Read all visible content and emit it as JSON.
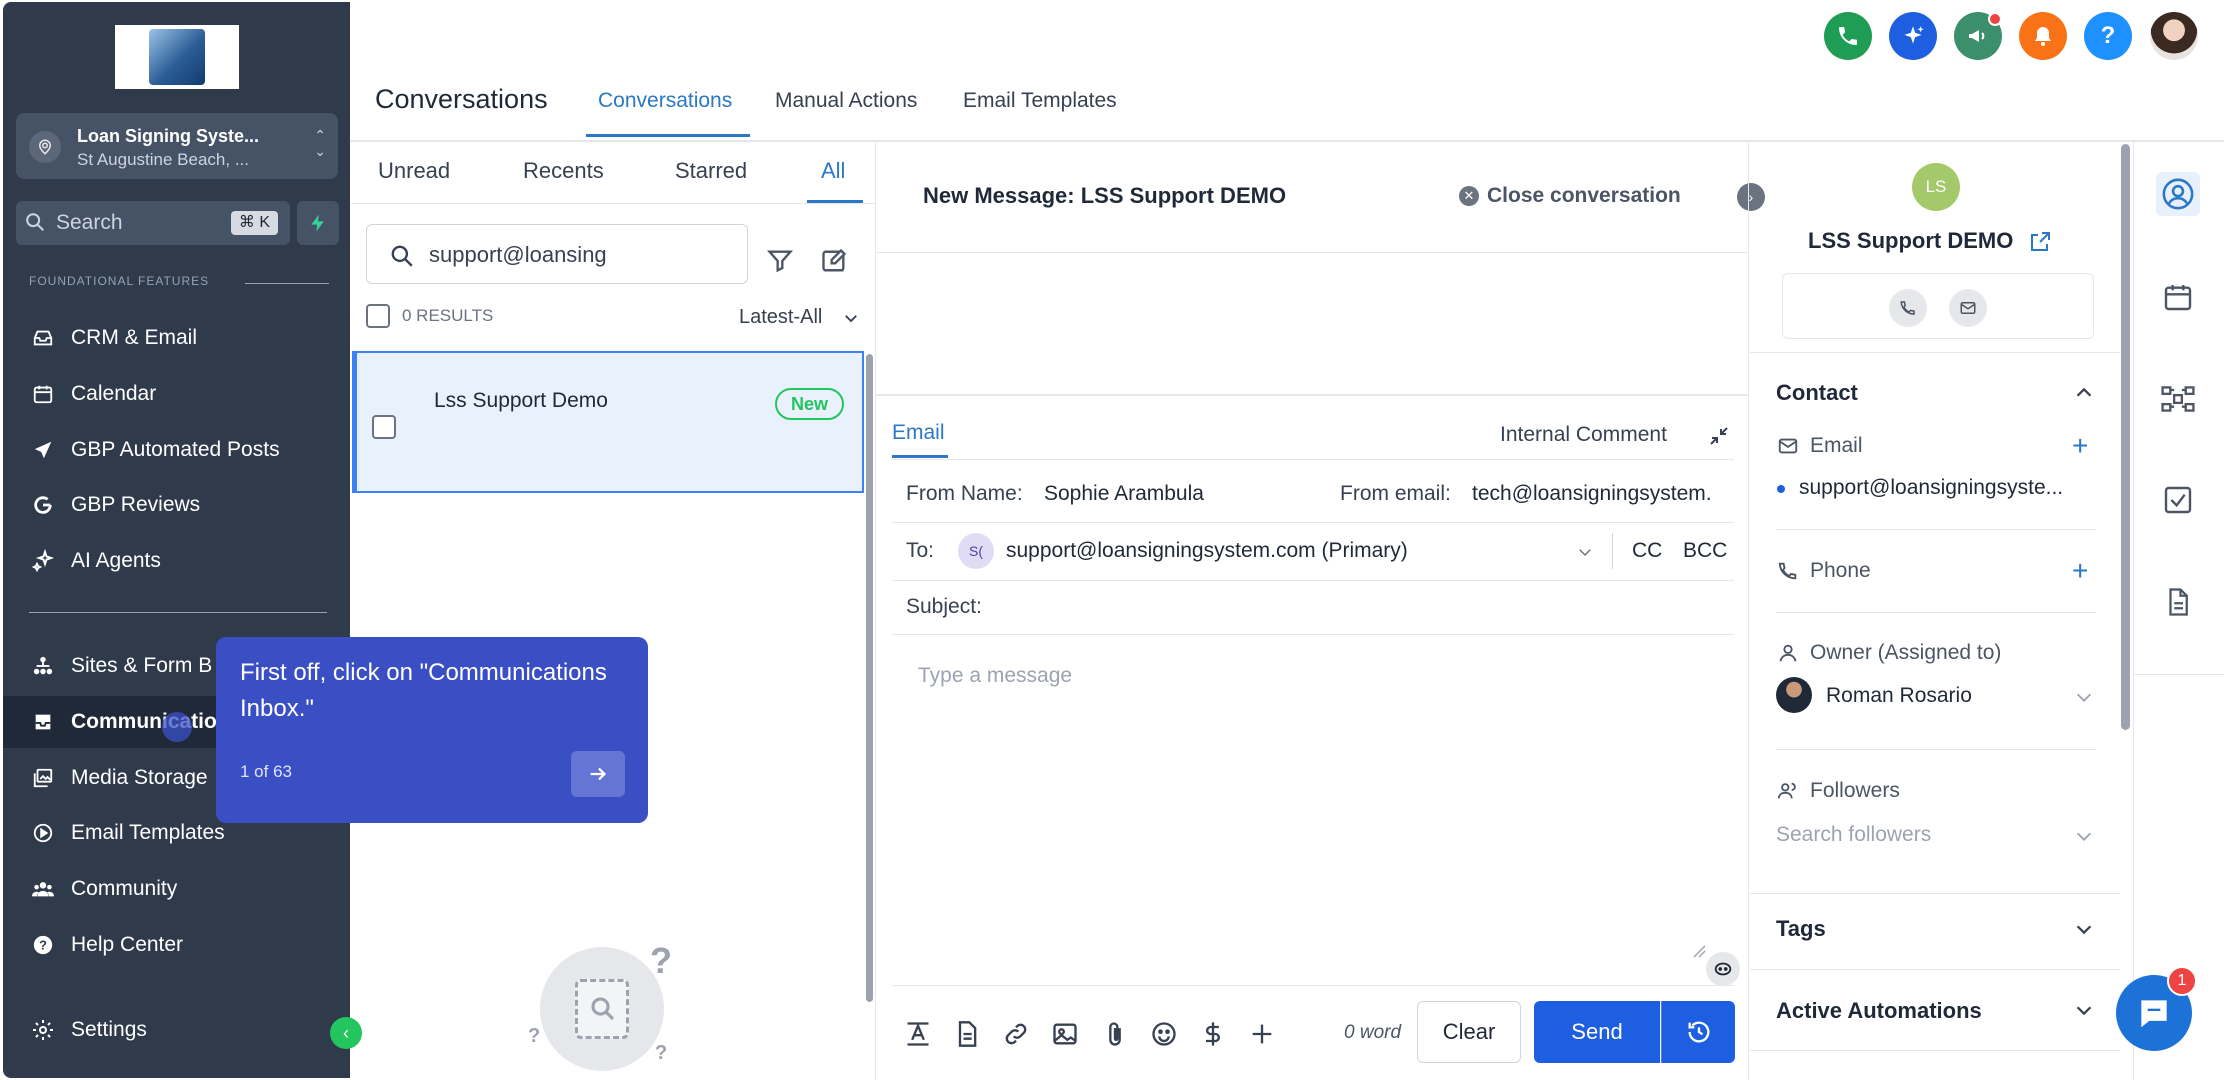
{
  "sidebar": {
    "location_name": "Loan Signing Syste...",
    "location_sub": "St Augustine Beach, ...",
    "search_label": "Search",
    "search_shortcut": "⌘ K",
    "section_label": "FOUNDATIONAL FEATURES",
    "items": [
      {
        "label": "CRM & Email",
        "icon": "inbox-icon"
      },
      {
        "label": "Calendar",
        "icon": "calendar-icon"
      },
      {
        "label": "GBP Automated Posts",
        "icon": "send-icon"
      },
      {
        "label": "GBP Reviews",
        "icon": "google-icon"
      },
      {
        "label": "AI Agents",
        "icon": "sparkles-icon"
      },
      {
        "label": "Sites & Form B",
        "icon": "sitemap-icon"
      },
      {
        "label": "Communicatio",
        "icon": "inbox-tray-icon"
      },
      {
        "label": "Media Storage",
        "icon": "photos-icon"
      },
      {
        "label": "Email Templates",
        "icon": "play-circle-icon"
      },
      {
        "label": "Community",
        "icon": "users-icon"
      },
      {
        "label": "Help Center",
        "icon": "help-circle-icon"
      },
      {
        "label": "Settings",
        "icon": "gear-icon"
      }
    ],
    "active_index": 6
  },
  "tour": {
    "text": "First off, click on \"Communications Inbox.\"",
    "step": "1 of 63"
  },
  "header": {
    "title": "Conversations",
    "tabs": [
      {
        "label": "Conversations"
      },
      {
        "label": "Manual Actions"
      },
      {
        "label": "Email Templates"
      }
    ],
    "active_tab": 0,
    "icons": [
      "phone-icon",
      "ai-sparkle-icon",
      "megaphone-icon",
      "bell-icon",
      "help-icon",
      "user-avatar"
    ],
    "colors": {
      "phone": "#1f9d55",
      "ai": "#1d5fe0",
      "megaphone": "#3b8f6b",
      "bell": "#f97316",
      "help": "#1e90ff"
    }
  },
  "list": {
    "tabs": [
      "Unread",
      "Recents",
      "Starred",
      "All"
    ],
    "active_tab": 3,
    "search_value": "support@loansing",
    "results_label": "0 RESULTS",
    "sort_label": "Latest-All",
    "items": [
      {
        "name": "Lss Support Demo",
        "badge": "New"
      }
    ]
  },
  "conversation": {
    "title": "New Message: LSS Support DEMO",
    "close_label": "Close conversation",
    "tabs": {
      "email": "Email",
      "internal": "Internal Comment"
    },
    "from_name_label": "From Name:",
    "from_name": "Sophie Arambula",
    "from_email_label": "From email:",
    "from_email": "tech@loansigningsystem.",
    "to_label": "To:",
    "to_avatar": "S(",
    "to_value": "support@loansigningsystem.com (Primary)",
    "cc": "CC",
    "bcc": "BCC",
    "subject_label": "Subject:",
    "message_placeholder": "Type a message",
    "word_count": "0 word",
    "clear_label": "Clear",
    "send_label": "Send",
    "toolbar_icons": [
      "text-format-icon",
      "document-icon",
      "link-icon",
      "image-icon",
      "paperclip-icon",
      "emoji-icon",
      "dollar-icon",
      "plus-icon"
    ]
  },
  "contact": {
    "initials": "LS",
    "name": "LSS Support DEMO",
    "section_contact": "Contact",
    "email_label": "Email",
    "email_value": "support@loansigningsyste...",
    "phone_label": "Phone",
    "owner_label": "Owner (Assigned to)",
    "owner_name": "Roman Rosario",
    "followers_label": "Followers",
    "followers_placeholder": "Search followers",
    "tags_label": "Tags",
    "automations_label": "Active Automations"
  },
  "rail": {
    "icons": [
      "contact-icon",
      "calendar-icon",
      "workflow-icon",
      "task-check-icon",
      "notes-icon"
    ],
    "chat_badge": "1"
  },
  "colors": {
    "sidebar_bg": "#2f3a4b",
    "accent": "#2b78c5",
    "primary_button": "#1d5fe0",
    "tour_bg": "#3b4fc4",
    "badge_new": "#22c55e"
  }
}
